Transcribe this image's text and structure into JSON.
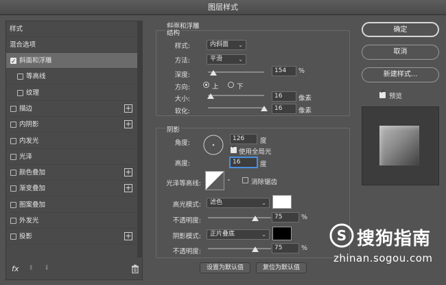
{
  "window": {
    "title": "图层样式"
  },
  "styles_list": {
    "header": "样式",
    "blend_options": "混合选项",
    "items": [
      {
        "label": "斜面和浮雕",
        "checked": true,
        "selected": true,
        "plus": false,
        "indent": false
      },
      {
        "label": "等高线",
        "checked": false,
        "selected": false,
        "plus": false,
        "indent": true
      },
      {
        "label": "纹理",
        "checked": false,
        "selected": false,
        "plus": false,
        "indent": true
      },
      {
        "label": "描边",
        "checked": false,
        "selected": false,
        "plus": true,
        "indent": false
      },
      {
        "label": "内阴影",
        "checked": false,
        "selected": false,
        "plus": true,
        "indent": false
      },
      {
        "label": "内发光",
        "checked": false,
        "selected": false,
        "plus": false,
        "indent": false
      },
      {
        "label": "光泽",
        "checked": false,
        "selected": false,
        "plus": false,
        "indent": false
      },
      {
        "label": "颜色叠加",
        "checked": false,
        "selected": false,
        "plus": true,
        "indent": false
      },
      {
        "label": "渐变叠加",
        "checked": false,
        "selected": false,
        "plus": true,
        "indent": false
      },
      {
        "label": "图案叠加",
        "checked": false,
        "selected": false,
        "plus": false,
        "indent": false
      },
      {
        "label": "外发光",
        "checked": false,
        "selected": false,
        "plus": false,
        "indent": false
      },
      {
        "label": "投影",
        "checked": false,
        "selected": false,
        "plus": true,
        "indent": false
      }
    ],
    "fx_label": "fx"
  },
  "bevel": {
    "section_title": "斜面和浮雕",
    "structure_title": "结构",
    "style_label": "样式:",
    "style_value": "内斜面",
    "technique_label": "方法:",
    "technique_value": "平滑",
    "depth_label": "深度:",
    "depth_value": "154",
    "depth_unit": "%",
    "depth_slider_fraction": 0.1,
    "direction_label": "方向:",
    "direction_up": "上",
    "direction_down": "下",
    "size_label": "大小:",
    "size_value": "16",
    "size_unit": "像素",
    "size_slider_fraction": 0.05,
    "soften_label": "软化:",
    "soften_value": "16",
    "soften_unit": "像素",
    "soften_slider_fraction": 1.0
  },
  "shading": {
    "title": "阴影",
    "angle_label": "角度:",
    "angle_value": "126",
    "angle_unit": "度",
    "global_light_label": "使用全局光",
    "global_light_checked": true,
    "altitude_label": "高度:",
    "altitude_value": "16",
    "altitude_unit": "度",
    "gloss_contour_label": "光泽等高线:",
    "anti_alias_label": "消除锯齿",
    "anti_alias_checked": false,
    "highlight_mode_label": "高光模式:",
    "highlight_mode_value": "滤色",
    "highlight_color": "#ffffff",
    "highlight_opacity_label": "不透明度:",
    "highlight_opacity_value": "75",
    "highlight_opacity_unit": "%",
    "highlight_opacity_fraction": 0.75,
    "shadow_mode_label": "阴影模式:",
    "shadow_mode_value": "正片叠底",
    "shadow_color": "#000000",
    "shadow_opacity_label": "不透明度:",
    "shadow_opacity_value": "75",
    "shadow_opacity_unit": "%",
    "shadow_opacity_fraction": 0.75
  },
  "defaults": {
    "make_default": "设置为默认值",
    "reset_default": "复位为默认值"
  },
  "actions": {
    "ok": "确定",
    "cancel": "取消",
    "new_style": "新建样式...",
    "preview_label": "预览",
    "preview_checked": true
  },
  "watermark": {
    "brand": "搜狗指南",
    "url": "zhinan.sogou.com"
  }
}
